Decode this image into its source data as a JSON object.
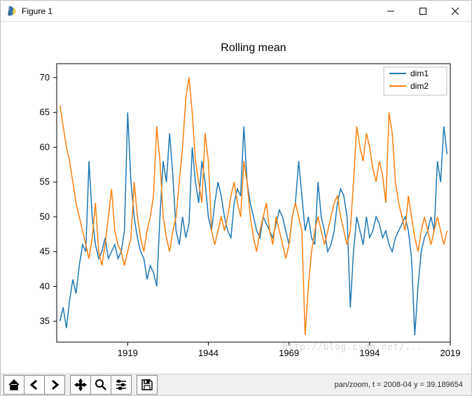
{
  "window": {
    "title": "Figure 1"
  },
  "toolbar": {
    "home": "home-icon",
    "back": "arrow-left-icon",
    "forward": "arrow-right-icon",
    "pan": "move-icon",
    "zoom": "zoom-icon",
    "configure": "sliders-icon",
    "save": "save-icon"
  },
  "status": {
    "text": "pan/zoom, t = 2008-04  y = 39.189654"
  },
  "watermark": "http://blog.csdn.net/...",
  "chart_data": {
    "type": "line",
    "title": "Rolling mean",
    "xlabel": "",
    "ylabel": "",
    "xlim": [
      1897,
      2019
    ],
    "ylim": [
      32,
      72
    ],
    "xticks": [
      1919,
      1944,
      1969,
      1994,
      2019
    ],
    "yticks": [
      35,
      40,
      45,
      50,
      55,
      60,
      65,
      70
    ],
    "legend": {
      "position": "upper right",
      "entries": [
        "dim1",
        "dim2"
      ]
    },
    "colors": {
      "dim1": "#1f77b4",
      "dim2": "#ff7f0e"
    },
    "series": [
      {
        "name": "dim1",
        "x": [
          1898,
          1899,
          1900,
          1901,
          1902,
          1903,
          1904,
          1905,
          1906,
          1907,
          1908,
          1909,
          1910,
          1911,
          1912,
          1913,
          1914,
          1915,
          1916,
          1917,
          1918,
          1919,
          1920,
          1921,
          1922,
          1923,
          1924,
          1925,
          1926,
          1927,
          1928,
          1929,
          1930,
          1931,
          1932,
          1933,
          1934,
          1935,
          1936,
          1937,
          1938,
          1939,
          1940,
          1941,
          1942,
          1943,
          1944,
          1945,
          1946,
          1947,
          1948,
          1949,
          1950,
          1951,
          1952,
          1953,
          1954,
          1955,
          1956,
          1957,
          1958,
          1959,
          1960,
          1961,
          1962,
          1963,
          1964,
          1965,
          1966,
          1967,
          1968,
          1969,
          1970,
          1971,
          1972,
          1973,
          1974,
          1975,
          1976,
          1977,
          1978,
          1979,
          1980,
          1981,
          1982,
          1983,
          1984,
          1985,
          1986,
          1987,
          1988,
          1989,
          1990,
          1991,
          1992,
          1993,
          1994,
          1995,
          1996,
          1997,
          1998,
          1999,
          2000,
          2001,
          2002,
          2003,
          2004,
          2005,
          2006,
          2007,
          2008,
          2009,
          2010,
          2011,
          2012,
          2013,
          2014,
          2015,
          2016,
          2017,
          2018
        ],
        "values": [
          35,
          37,
          34,
          38,
          41,
          39,
          43,
          46,
          45,
          58,
          50,
          46,
          44,
          45,
          47,
          44,
          45,
          46,
          44,
          45,
          48,
          65,
          55,
          50,
          47,
          45,
          44,
          41,
          43,
          42,
          40,
          50,
          58,
          55,
          62,
          56,
          48,
          46,
          50,
          47,
          49,
          60,
          55,
          52,
          58,
          55,
          50,
          48,
          52,
          55,
          53,
          50,
          48,
          47,
          52,
          54,
          53,
          63,
          55,
          52,
          50,
          48,
          47,
          50,
          49,
          48,
          47,
          49,
          51,
          50,
          48,
          46,
          50,
          52,
          58,
          53,
          48,
          50,
          47,
          46,
          55,
          50,
          48,
          45,
          46,
          48,
          52,
          54,
          53,
          50,
          37,
          45,
          50,
          48,
          46,
          50,
          47,
          48,
          50,
          49,
          47,
          48,
          46,
          45,
          47,
          48,
          49,
          50,
          48,
          44,
          33,
          40,
          45,
          47,
          48,
          50,
          48,
          58,
          55,
          63,
          59
        ]
      },
      {
        "name": "dim2",
        "x": [
          1898,
          1899,
          1900,
          1901,
          1902,
          1903,
          1904,
          1905,
          1906,
          1907,
          1908,
          1909,
          1910,
          1911,
          1912,
          1913,
          1914,
          1915,
          1916,
          1917,
          1918,
          1919,
          1920,
          1921,
          1922,
          1923,
          1924,
          1925,
          1926,
          1927,
          1928,
          1929,
          1930,
          1931,
          1932,
          1933,
          1934,
          1935,
          1936,
          1937,
          1938,
          1939,
          1940,
          1941,
          1942,
          1943,
          1944,
          1945,
          1946,
          1947,
          1948,
          1949,
          1950,
          1951,
          1952,
          1953,
          1954,
          1955,
          1956,
          1957,
          1958,
          1959,
          1960,
          1961,
          1962,
          1963,
          1964,
          1965,
          1966,
          1967,
          1968,
          1969,
          1970,
          1971,
          1972,
          1973,
          1974,
          1975,
          1976,
          1977,
          1978,
          1979,
          1980,
          1981,
          1982,
          1983,
          1984,
          1985,
          1986,
          1987,
          1988,
          1989,
          1990,
          1991,
          1992,
          1993,
          1994,
          1995,
          1996,
          1997,
          1998,
          1999,
          2000,
          2001,
          2002,
          2003,
          2004,
          2005,
          2006,
          2007,
          2008,
          2009,
          2010,
          2011,
          2012,
          2013,
          2014,
          2015,
          2016,
          2017,
          2018
        ],
        "values": [
          66,
          63,
          60,
          58,
          55,
          52,
          50,
          48,
          46,
          44,
          47,
          52,
          45,
          43,
          46,
          50,
          54,
          48,
          46,
          45,
          43,
          45,
          47,
          55,
          50,
          47,
          45,
          48,
          50,
          53,
          63,
          58,
          50,
          47,
          45,
          48,
          50,
          55,
          60,
          67,
          70,
          65,
          58,
          55,
          52,
          62,
          58,
          48,
          46,
          48,
          50,
          48,
          50,
          53,
          55,
          52,
          50,
          58,
          55,
          50,
          47,
          45,
          48,
          50,
          52,
          48,
          46,
          50,
          48,
          46,
          44,
          46,
          50,
          52,
          50,
          48,
          33,
          40,
          45,
          48,
          50,
          48,
          46,
          48,
          50,
          52,
          53,
          50,
          48,
          46,
          48,
          55,
          63,
          60,
          58,
          62,
          60,
          57,
          55,
          58,
          56,
          52,
          65,
          62,
          55,
          52,
          50,
          48,
          53,
          50,
          47,
          45,
          48,
          50,
          48,
          46,
          48,
          50,
          48,
          46,
          48
        ]
      }
    ]
  }
}
